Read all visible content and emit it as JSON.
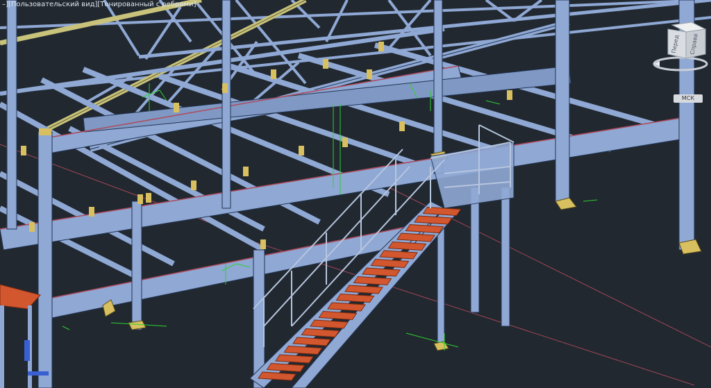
{
  "viewport": {
    "label_prefix": "–][",
    "view_name": "Пользовательский вид",
    "sep1": "][",
    "visual_style": "Тонированный с ребрами",
    "label_suffix": "]"
  },
  "viewcube": {
    "face_front": "Перед",
    "face_right": "Справа"
  },
  "ucs": {
    "label": "МСК"
  },
  "colors": {
    "background": "#212830",
    "steel": "#8fa8d4",
    "steel_edge": "#233552",
    "truss_top": "#c8c27a",
    "stair_tread": "#d3572e",
    "base_plate": "#d8c060",
    "dimension": "#2fd12f",
    "axis_line": "#b04a5a"
  }
}
